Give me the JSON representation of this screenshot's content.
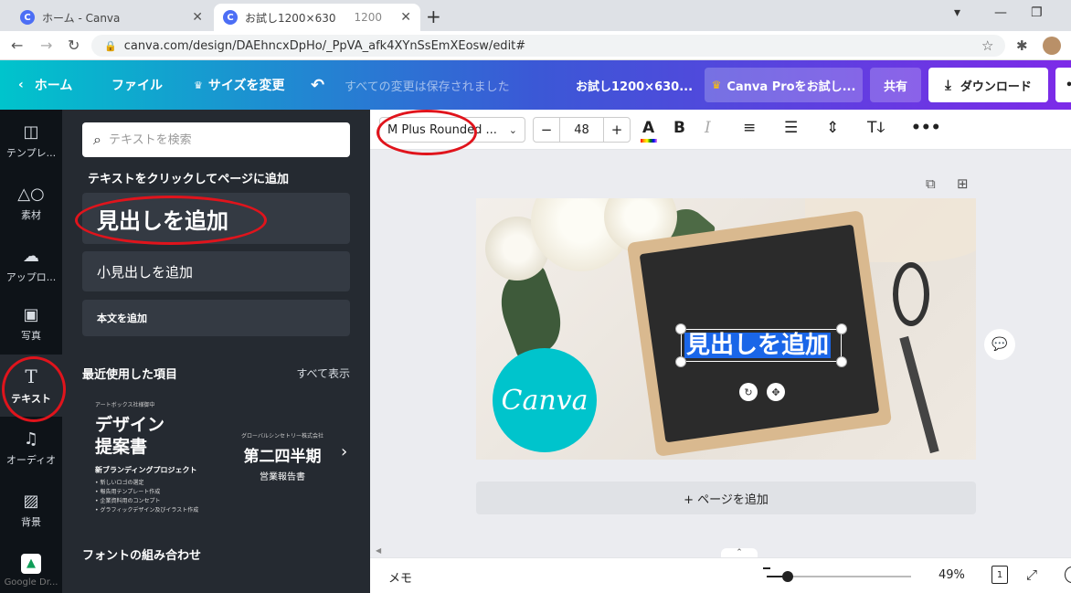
{
  "browser": {
    "tabs": [
      {
        "label": "ホーム - Canva"
      },
      {
        "label": "お試し1200×630",
        "extra": "1200"
      }
    ],
    "url": "canva.com/design/DAEhncxDpHo/_PpVA_afk4XYnSsEmXEosw/edit#"
  },
  "topbar": {
    "home": "ホーム",
    "file": "ファイル",
    "resize": "サイズを変更",
    "saved_status": "すべての変更は保存されました",
    "doc_title": "お試し1200×630...",
    "pro": "Canva Proをお試し...",
    "share": "共有",
    "download": "ダウンロード"
  },
  "rail": {
    "items": [
      {
        "label": "テンプレ...",
        "icon": "template-icon"
      },
      {
        "label": "素材",
        "icon": "elements-icon"
      },
      {
        "label": "アップロ...",
        "icon": "upload-icon"
      },
      {
        "label": "写真",
        "icon": "photo-icon"
      },
      {
        "label": "テキスト",
        "icon": "text-icon"
      },
      {
        "label": "オーディオ",
        "icon": "music-icon"
      },
      {
        "label": "背景",
        "icon": "background-icon"
      },
      {
        "label": "Google Dr...",
        "icon": "google-drive-icon"
      }
    ]
  },
  "panel": {
    "search_placeholder": "テキストを検索",
    "instruction": "テキストをクリックしてページに追加",
    "add_heading": "見出しを追加",
    "add_subheading": "小見出しを追加",
    "add_body": "本文を追加",
    "recent_title": "最近使用した項目",
    "see_all": "すべて表示",
    "thumb1": {
      "small": "アートボックス社様御中",
      "big_line1": "デザイン",
      "big_line2": "提案書",
      "sub": "新ブランディングプロジェクト",
      "bullets": [
        "新しいロゴの選定",
        "報告用テンプレート作成",
        "企業資料用のコンセプト",
        "グラフィックデザイン及びイラスト作成"
      ]
    },
    "thumb2": {
      "small": "グローバルシンセトリー株式会社",
      "big": "第二四半期",
      "sub": "営業報告書"
    },
    "combo_title": "フォントの組み合わせ"
  },
  "toolbar": {
    "font": "M Plus Rounded ...",
    "size_minus": "−",
    "size": "48",
    "size_plus": "+"
  },
  "canvas": {
    "selected_text": "見出しを追加",
    "logo_text": "Canva",
    "add_page": "+ ページを追加"
  },
  "footer": {
    "memo": "メモ",
    "zoom_percent": 49,
    "zoom_label": "49%",
    "page_num": "1"
  },
  "colors": {
    "annotation": "#e0141c",
    "selection": "#1a66e8",
    "logo": "#00c4cc"
  }
}
